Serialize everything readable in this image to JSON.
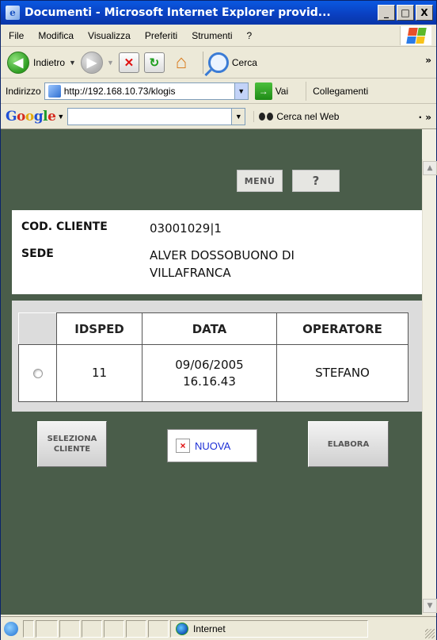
{
  "window": {
    "title": "Documenti - Microsoft Internet Explorer provid...",
    "controls": [
      "_",
      "□",
      "X"
    ]
  },
  "menubar": {
    "items": [
      "File",
      "Modifica",
      "Visualizza",
      "Preferiti",
      "Strumenti",
      "?"
    ]
  },
  "toolbar": {
    "back_label": "Indietro",
    "search_label": "Cerca"
  },
  "address": {
    "label": "Indirizzo",
    "url": "http://192.168.10.73/klogis",
    "go_label": "Vai",
    "links_label": "Collegamenti"
  },
  "google": {
    "logo": [
      "G",
      "o",
      "o",
      "g",
      "l",
      "e"
    ],
    "search_value": "",
    "search_web_label": "Cerca nel Web"
  },
  "page": {
    "menu_button": "MENÙ",
    "help_button": "?",
    "client": {
      "code_label": "COD. CLIENTE",
      "code_value": "03001029|1",
      "site_label": "SEDE",
      "site_value_line1": "ALVER DOSSOBUONO DI",
      "site_value_line2": "VILLAFRANCA"
    },
    "table": {
      "headers": [
        "IDSPED",
        "DATA",
        "OPERATORE"
      ],
      "rows": [
        {
          "selected": false,
          "idsped": "11",
          "date": "09/06/2005",
          "time": "16.16.43",
          "operator": "STEFANO"
        }
      ]
    },
    "actions": {
      "select_client_line1": "SELEZIONA",
      "select_client_line2": "CLIENTE",
      "new_label": "NUOVA",
      "process_label": "ELABORA"
    }
  },
  "statusbar": {
    "zone": "Internet"
  },
  "colors": {
    "page_background": "#4a5d4a",
    "link_blue": "#1d2fd6",
    "title_bar": "#0a3fbf"
  }
}
